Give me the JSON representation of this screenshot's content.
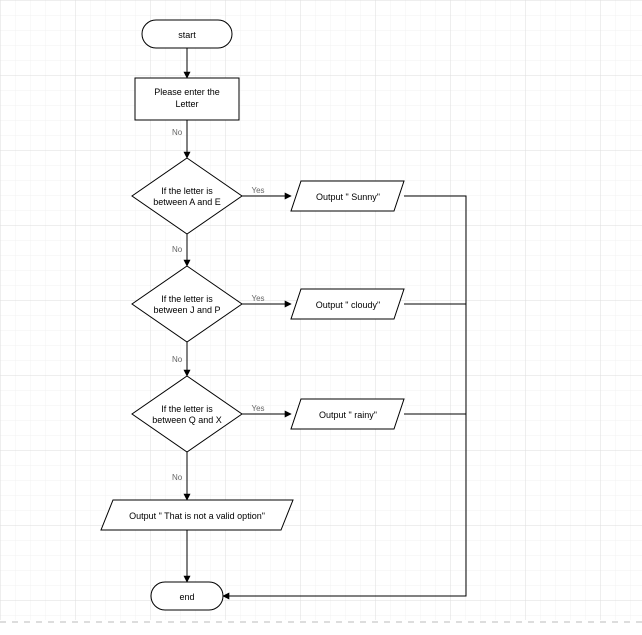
{
  "flowchart": {
    "start": "start",
    "input": {
      "line1": "Please enter the",
      "line2": "Letter"
    },
    "dec1": {
      "line1": "If the letter is",
      "line2": "between A and E"
    },
    "dec2": {
      "line1": "If the letter is",
      "line2": "between J and P"
    },
    "dec3": {
      "line1": "If the letter is",
      "line2": "between Q and X"
    },
    "out1": "Output \" Sunny\"",
    "out2": "Output \" cloudy\"",
    "out3": "Output \" rainy\"",
    "out4": "Output \" That is not a valid option\"",
    "end": "end",
    "yes": "Yes",
    "no": "No"
  }
}
